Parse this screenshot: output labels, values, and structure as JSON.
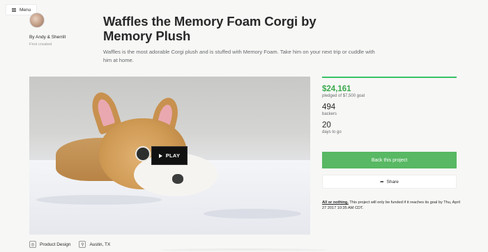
{
  "menu": {
    "label": "Menu",
    "icon": "hamburger-icon"
  },
  "creator": {
    "byline": "By Andy & Sherrill",
    "first_created": "First created"
  },
  "project": {
    "title": "Waffles the Memory Foam Corgi by Memory Plush",
    "blurb": "Waffles is the most adorable Corgi plush and is stuffed with Memory Foam. Take him on your next trip or cuddle with him at home."
  },
  "video": {
    "play_label": "PLAY"
  },
  "stats": {
    "funded_fraction": 1.0,
    "pledged": "$24,161",
    "pledged_label": "pledged of $7,500 goal",
    "backers": "494",
    "backers_label": "backers",
    "days": "20",
    "days_label": "days to go"
  },
  "actions": {
    "back_label": "Back this project",
    "share_label": "Share"
  },
  "fine_print": {
    "bold": "All or nothing.",
    "text": " This project will only be funded if it reaches its goal by Thu, April 27 2017 10:35 AM CDT."
  },
  "tags": {
    "category": "Product Design",
    "location": "Austin, TX"
  },
  "colors": {
    "accent_green": "#37c265",
    "button_green": "#58b863",
    "pledged_green": "#3aa94c"
  }
}
